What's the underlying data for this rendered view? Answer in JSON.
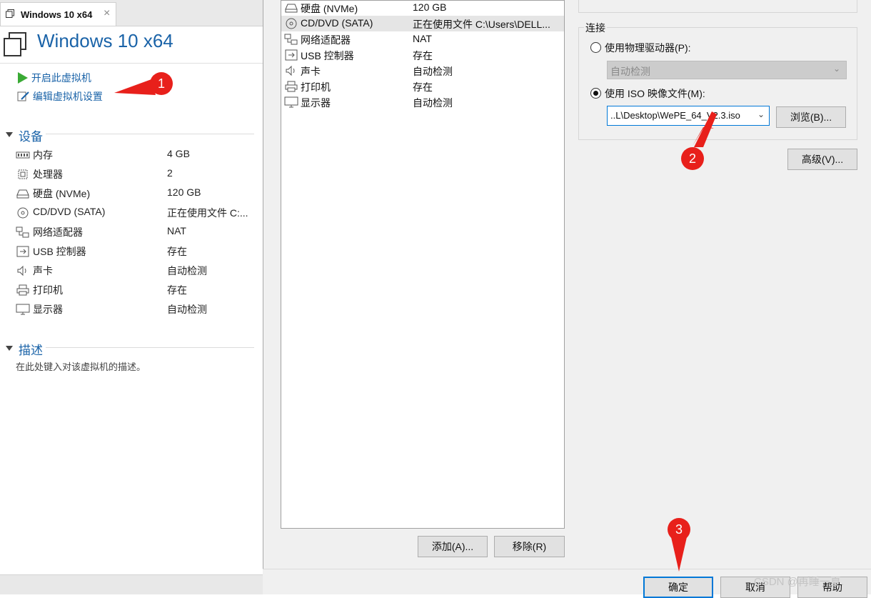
{
  "tab": {
    "title": "Windows 10 x64",
    "close_glyph": "×"
  },
  "vm": {
    "title": "Windows 10 x64",
    "actions": {
      "start": "开启此虚拟机",
      "edit": "编辑虚拟机设置"
    }
  },
  "devices_section": {
    "heading": "设备",
    "items": [
      {
        "icon": "memory-icon",
        "name": "内存",
        "value": "4 GB"
      },
      {
        "icon": "processor-icon",
        "name": "处理器",
        "value": "2"
      },
      {
        "icon": "harddisk-icon",
        "name": "硬盘 (NVMe)",
        "value": "120 GB"
      },
      {
        "icon": "cd-dvd-icon",
        "name": "CD/DVD (SATA)",
        "value": "正在使用文件 C:..."
      },
      {
        "icon": "network-adapter-icon",
        "name": "网络适配器",
        "value": "NAT"
      },
      {
        "icon": "usb-icon",
        "name": "USB 控制器",
        "value": "存在"
      },
      {
        "icon": "sound-icon",
        "name": "声卡",
        "value": "自动检测"
      },
      {
        "icon": "printer-icon",
        "name": "打印机",
        "value": "存在"
      },
      {
        "icon": "display-icon",
        "name": "显示器",
        "value": "自动检测"
      }
    ]
  },
  "description_section": {
    "heading": "描述",
    "text": "在此处键入对该虚拟机的描述。"
  },
  "hardware_list": [
    {
      "icon": "harddisk-icon",
      "name": "硬盘 (NVMe)",
      "value": "120 GB",
      "selected": false
    },
    {
      "icon": "cd-dvd-icon",
      "name": "CD/DVD (SATA)",
      "value": "正在使用文件 C:\\Users\\DELL...",
      "selected": true
    },
    {
      "icon": "network-adapter-icon",
      "name": "网络适配器",
      "value": "NAT",
      "selected": false
    },
    {
      "icon": "usb-icon",
      "name": "USB 控制器",
      "value": "存在",
      "selected": false
    },
    {
      "icon": "sound-icon",
      "name": "声卡",
      "value": "自动检测",
      "selected": false
    },
    {
      "icon": "printer-icon",
      "name": "打印机",
      "value": "存在",
      "selected": false
    },
    {
      "icon": "display-icon",
      "name": "显示器",
      "value": "自动检测",
      "selected": false
    }
  ],
  "list_buttons": {
    "add": "添加(A)...",
    "remove": "移除(R)"
  },
  "connection": {
    "label": "连接",
    "physical_radio": "使用物理驱动器(P):",
    "physical_select_value": "自动检测",
    "iso_radio": "使用 ISO 映像文件(M):",
    "iso_path": "..L\\Desktop\\WePE_64_V2.3.iso",
    "browse": "浏览(B)...",
    "selected": "iso"
  },
  "advanced_button": "高级(V)...",
  "dialog_buttons": {
    "ok": "确定",
    "cancel": "取消",
    "help": "帮助"
  },
  "annotations": [
    "1",
    "2",
    "3"
  ],
  "watermark": "CSDN @再睡一夏.",
  "colors": {
    "accent": "#1a63a8",
    "annotation": "#e8201b",
    "focus": "#0078d7"
  }
}
